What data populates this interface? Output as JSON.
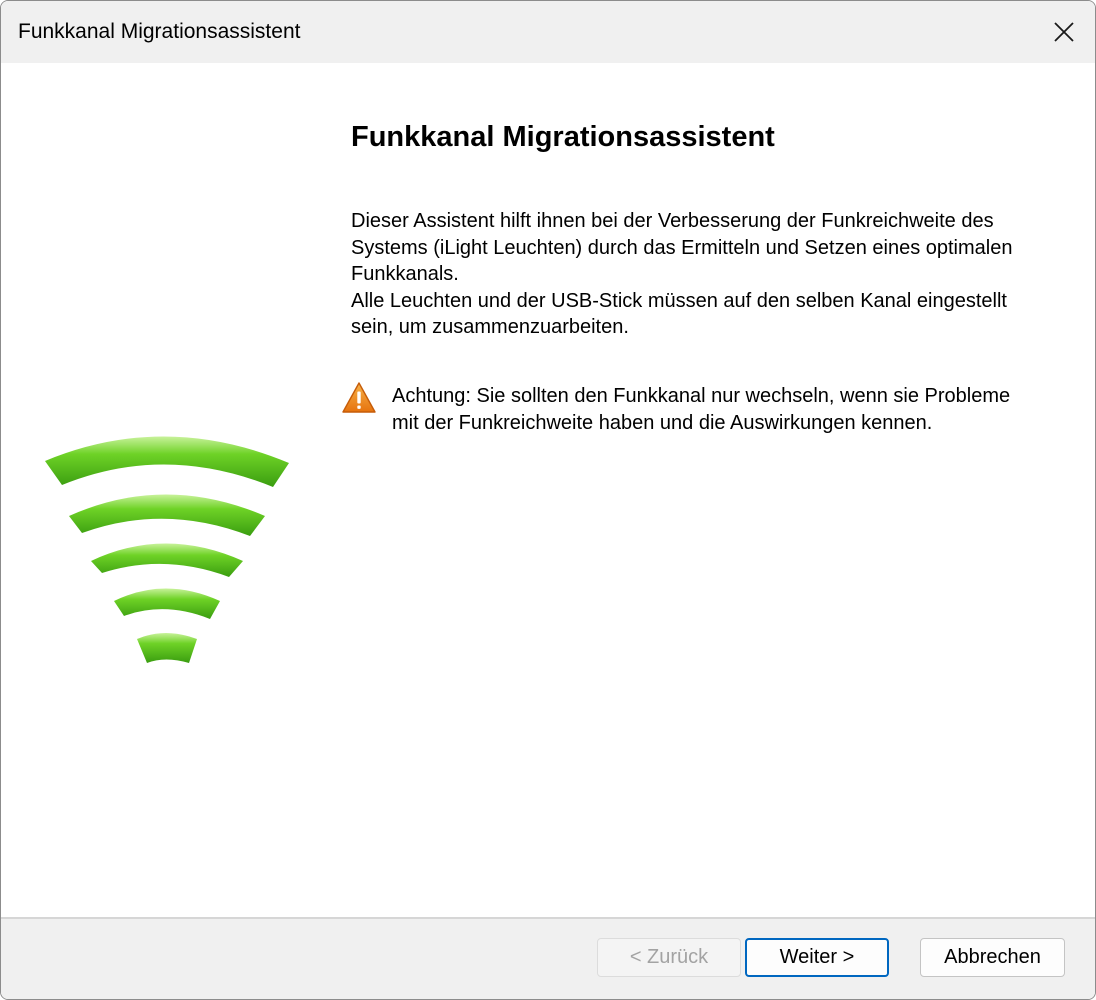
{
  "window": {
    "title": "Funkkanal Migrationsassistent"
  },
  "wizard": {
    "heading": "Funkkanal Migrationsassistent",
    "description_lines": [
      "Dieser Assistent hilft ihnen bei der Verbesserung der Funkreichweite des",
      "Systems (iLight Leuchten) durch das Ermitteln und Setzen eines optimalen",
      "Funkkanals.",
      "Alle Leuchten und der USB-Stick müssen auf den selben Kanal eingestellt",
      "sein, um zusammenzuarbeiten."
    ],
    "warning_lines": [
      "Achtung: Sie sollten den Funkkanal nur wechseln, wenn sie Probleme",
      "mit der Funkreichweite haben und die Auswirkungen kennen."
    ]
  },
  "buttons": {
    "back": "< Zurück",
    "next": "Weiter >",
    "cancel": "Abbrechen"
  },
  "icons": {
    "close": "close-icon",
    "wifi": "wireless-signal-icon",
    "warning": "warning-icon"
  },
  "colors": {
    "signal_green": "#5cc61e",
    "warning_orange": "#f08a1c",
    "primary_button_border": "#0067c0",
    "titlebar_bg": "#f0f0f0",
    "footer_bg": "#f0f0f0"
  }
}
